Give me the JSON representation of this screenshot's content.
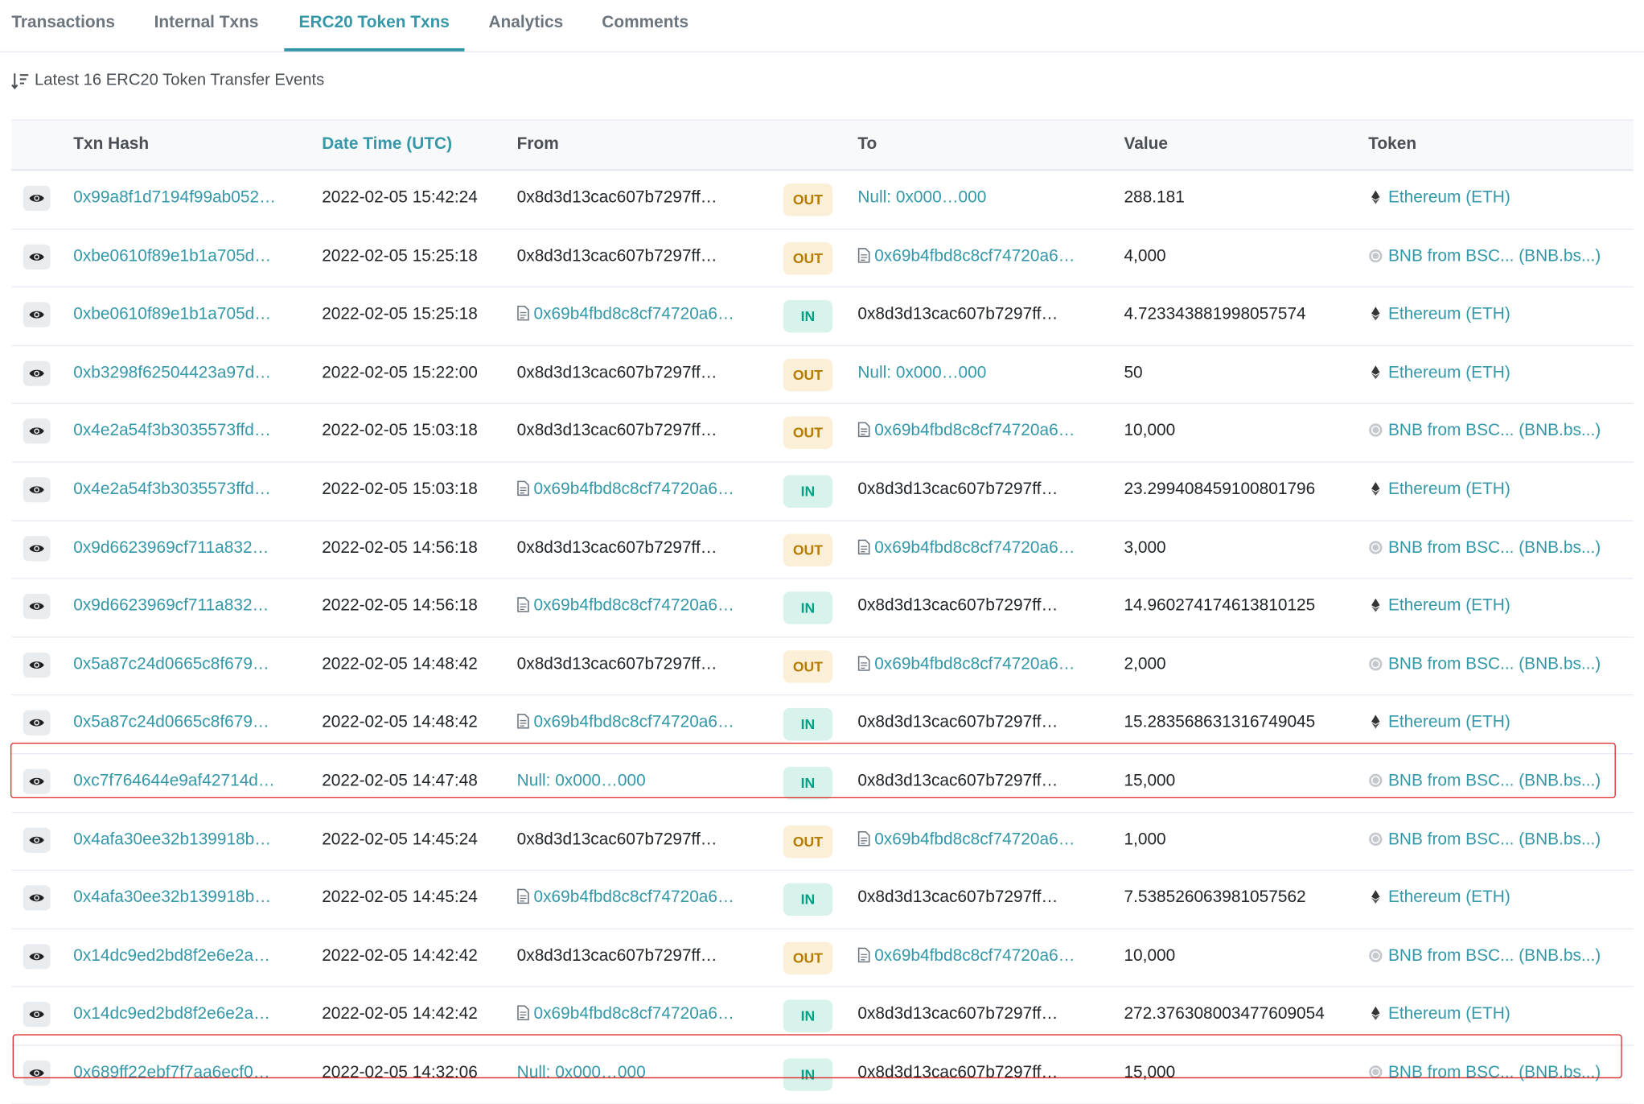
{
  "tabs": [
    "Transactions",
    "Internal Txns",
    "ERC20 Token Txns",
    "Analytics",
    "Comments"
  ],
  "summary": "Latest 16 ERC20 Token Transfer Events",
  "columns": {
    "hash": "Txn Hash",
    "date": "Date Time (UTC)",
    "from": "From",
    "to": "To",
    "value": "Value",
    "token": "Token"
  },
  "rows": [
    {
      "hash": "0x99a8f1d7194f99ab052…",
      "date": "2022-02-05 15:42:24",
      "from": "0x8d3d13cac607b7297ff…",
      "dir": "OUT",
      "to": "Null: 0x000…000",
      "value": "288.181",
      "token": "Ethereum (ETH)"
    },
    {
      "hash": "0xbe0610f89e1b1a705d…",
      "date": "2022-02-05 15:25:18",
      "from": "0x8d3d13cac607b7297ff…",
      "dir": "OUT",
      "to": "0x69b4fbd8c8cf74720a6…",
      "value": "4,000",
      "token": "BNB from BSC... (BNB.bs...)"
    },
    {
      "hash": "0xbe0610f89e1b1a705d…",
      "date": "2022-02-05 15:25:18",
      "from": "0x69b4fbd8c8cf74720a6…",
      "dir": "IN",
      "to": "0x8d3d13cac607b7297ff…",
      "value": "4.723343881998057574",
      "token": "Ethereum (ETH)"
    },
    {
      "hash": "0xb3298f62504423a97d…",
      "date": "2022-02-05 15:22:00",
      "from": "0x8d3d13cac607b7297ff…",
      "dir": "OUT",
      "to": "Null: 0x000…000",
      "value": "50",
      "token": "Ethereum (ETH)"
    },
    {
      "hash": "0x4e2a54f3b3035573ffd…",
      "date": "2022-02-05 15:03:18",
      "from": "0x8d3d13cac607b7297ff…",
      "dir": "OUT",
      "to": "0x69b4fbd8c8cf74720a6…",
      "value": "10,000",
      "token": "BNB from BSC... (BNB.bs...)"
    },
    {
      "hash": "0x4e2a54f3b3035573ffd…",
      "date": "2022-02-05 15:03:18",
      "from": "0x69b4fbd8c8cf74720a6…",
      "dir": "IN",
      "to": "0x8d3d13cac607b7297ff…",
      "value": "23.299408459100801796",
      "token": "Ethereum (ETH)"
    },
    {
      "hash": "0x9d6623969cf711a832…",
      "date": "2022-02-05 14:56:18",
      "from": "0x8d3d13cac607b7297ff…",
      "dir": "OUT",
      "to": "0x69b4fbd8c8cf74720a6…",
      "value": "3,000",
      "token": "BNB from BSC... (BNB.bs...)"
    },
    {
      "hash": "0x9d6623969cf711a832…",
      "date": "2022-02-05 14:56:18",
      "from": "0x69b4fbd8c8cf74720a6…",
      "dir": "IN",
      "to": "0x8d3d13cac607b7297ff…",
      "value": "14.960274174613810125",
      "token": "Ethereum (ETH)"
    },
    {
      "hash": "0x5a87c24d0665c8f679…",
      "date": "2022-02-05 14:48:42",
      "from": "0x8d3d13cac607b7297ff…",
      "dir": "OUT",
      "to": "0x69b4fbd8c8cf74720a6…",
      "value": "2,000",
      "token": "BNB from BSC... (BNB.bs...)"
    },
    {
      "hash": "0x5a87c24d0665c8f679…",
      "date": "2022-02-05 14:48:42",
      "from": "0x69b4fbd8c8cf74720a6…",
      "dir": "IN",
      "to": "0x8d3d13cac607b7297ff…",
      "value": "15.283568631316749045",
      "token": "Ethereum (ETH)"
    },
    {
      "hash": "0xc7f764644e9af42714d…",
      "date": "2022-02-05 14:47:48",
      "from": "Null: 0x000…000",
      "dir": "IN",
      "to": "0x8d3d13cac607b7297ff…",
      "value": "15,000",
      "token": "BNB from BSC... (BNB.bs...)"
    },
    {
      "hash": "0x4afa30ee32b139918b…",
      "date": "2022-02-05 14:45:24",
      "from": "0x8d3d13cac607b7297ff…",
      "dir": "OUT",
      "to": "0x69b4fbd8c8cf74720a6…",
      "value": "1,000",
      "token": "BNB from BSC... (BNB.bs...)"
    },
    {
      "hash": "0x4afa30ee32b139918b…",
      "date": "2022-02-05 14:45:24",
      "from": "0x69b4fbd8c8cf74720a6…",
      "dir": "IN",
      "to": "0x8d3d13cac607b7297ff…",
      "value": "7.538526063981057562",
      "token": "Ethereum (ETH)"
    },
    {
      "hash": "0x14dc9ed2bd8f2e6e2a…",
      "date": "2022-02-05 14:42:42",
      "from": "0x8d3d13cac607b7297ff…",
      "dir": "OUT",
      "to": "0x69b4fbd8c8cf74720a6…",
      "value": "10,000",
      "token": "BNB from BSC... (BNB.bs...)"
    },
    {
      "hash": "0x14dc9ed2bd8f2e6e2a…",
      "date": "2022-02-05 14:42:42",
      "from": "0x69b4fbd8c8cf74720a6…",
      "dir": "IN",
      "to": "0x8d3d13cac607b7297ff…",
      "value": "272.376308003477609054",
      "token": "Ethereum (ETH)"
    },
    {
      "hash": "0x689ff22ebf7f7aa6ecf0…",
      "date": "2022-02-05 14:32:06",
      "from": "Null: 0x000…000",
      "dir": "IN",
      "to": "0x8d3d13cac607b7297ff…",
      "value": "15,000",
      "token": "BNB from BSC... (BNB.bs...)"
    }
  ]
}
